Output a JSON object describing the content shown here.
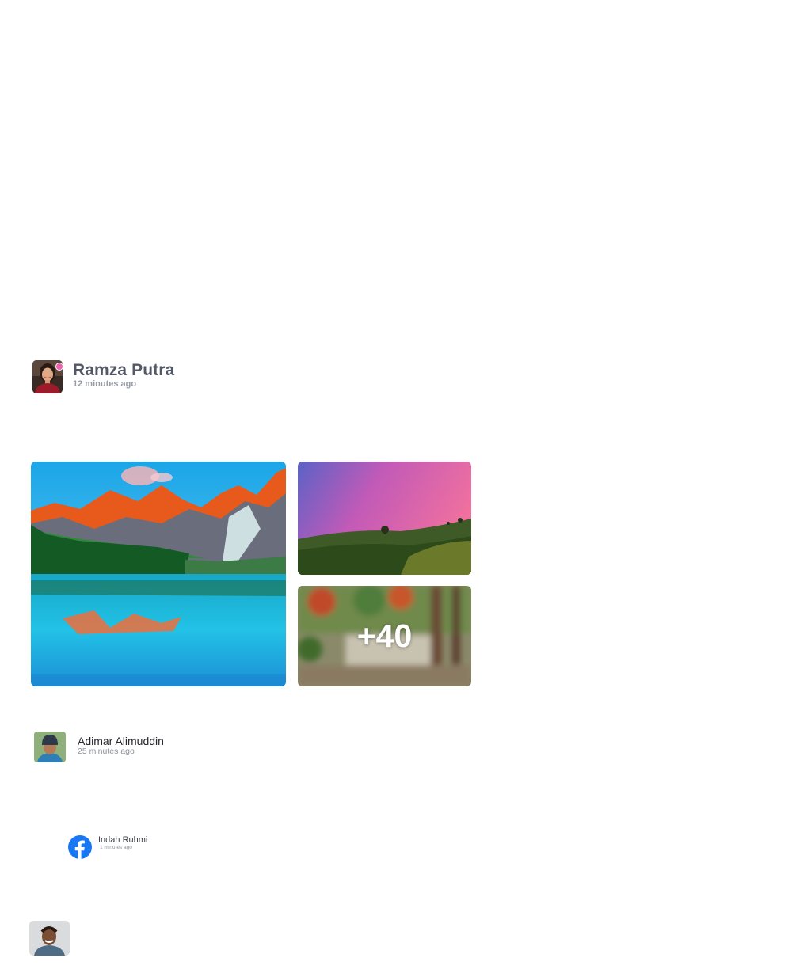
{
  "post": {
    "author": {
      "name": "Ramza Putra",
      "avatar_icon": "woman-portrait-avatar",
      "status_color": "#f25fae"
    },
    "time_ago": "12 minutes ago",
    "gallery": {
      "photos": [
        {
          "icon": "mountain-lake-photo"
        },
        {
          "icon": "pink-sky-hill-photo"
        },
        {
          "icon": "blurred-trees-photo"
        }
      ],
      "more_count": "+40"
    }
  },
  "comments": [
    {
      "name": "Adimar Alimuddin",
      "time_ago": "25 minutes ago",
      "avatar_icon": "man-beanie-avatar"
    },
    {
      "name": "Indah Ruhmi",
      "time_ago": "1 minutes ago",
      "avatar_icon": "facebook-icon",
      "brand_color": "#1877f2"
    },
    {
      "avatar_icon": "smiling-man-avatar"
    }
  ]
}
